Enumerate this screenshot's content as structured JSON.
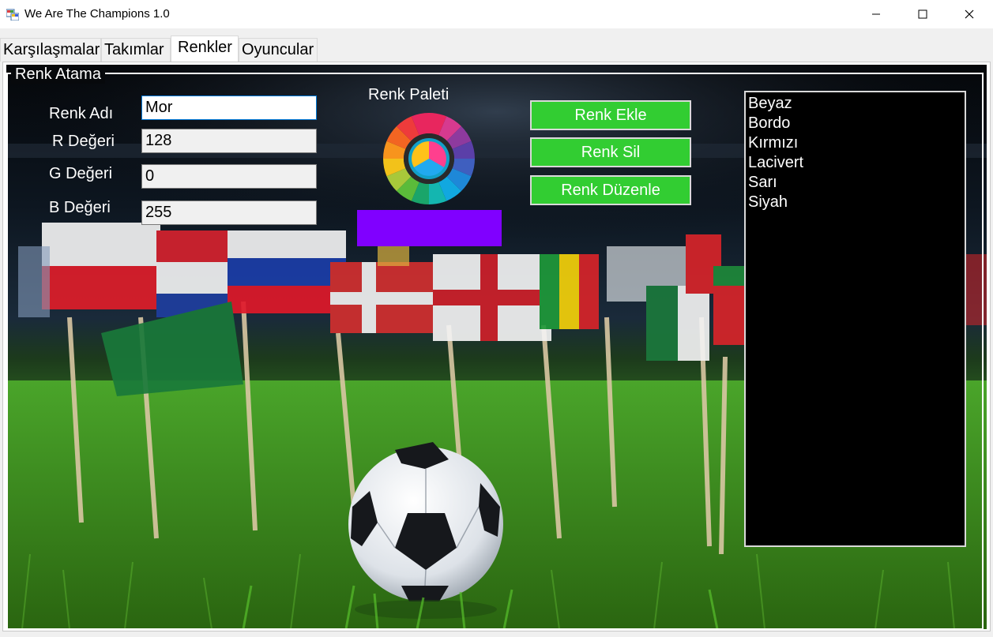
{
  "window": {
    "title": "We Are The Champions 1.0",
    "icon": "app-icon",
    "controls": [
      "minimize-icon",
      "maximize-icon",
      "close-icon"
    ]
  },
  "tabs": [
    {
      "label": "Karşılaşmalar",
      "active": false
    },
    {
      "label": "Takımlar",
      "active": false
    },
    {
      "label": "Renkler",
      "active": true
    },
    {
      "label": "Oyuncular",
      "active": false
    }
  ],
  "group": {
    "title": "Renk Atama"
  },
  "form": {
    "name_label": "Renk Adı",
    "name_value": "Mor",
    "r_label": "R Değeri",
    "r_value": "128",
    "g_label": "G Değeri",
    "g_value": "0",
    "b_label": "B Değeri",
    "b_value": "255"
  },
  "palette": {
    "label": "Renk Paleti",
    "icon": "color-wheel-icon",
    "preview_color": "#8000ff"
  },
  "buttons": {
    "add": "Renk Ekle",
    "delete": "Renk Sil",
    "edit": "Renk Düzenle",
    "color": "#32cd32"
  },
  "color_list": [
    "Beyaz",
    "Bordo",
    "Kırmızı",
    "Lacivert",
    "Sarı",
    "Siyah"
  ],
  "background": {
    "description_icon": "football-flags-background"
  }
}
